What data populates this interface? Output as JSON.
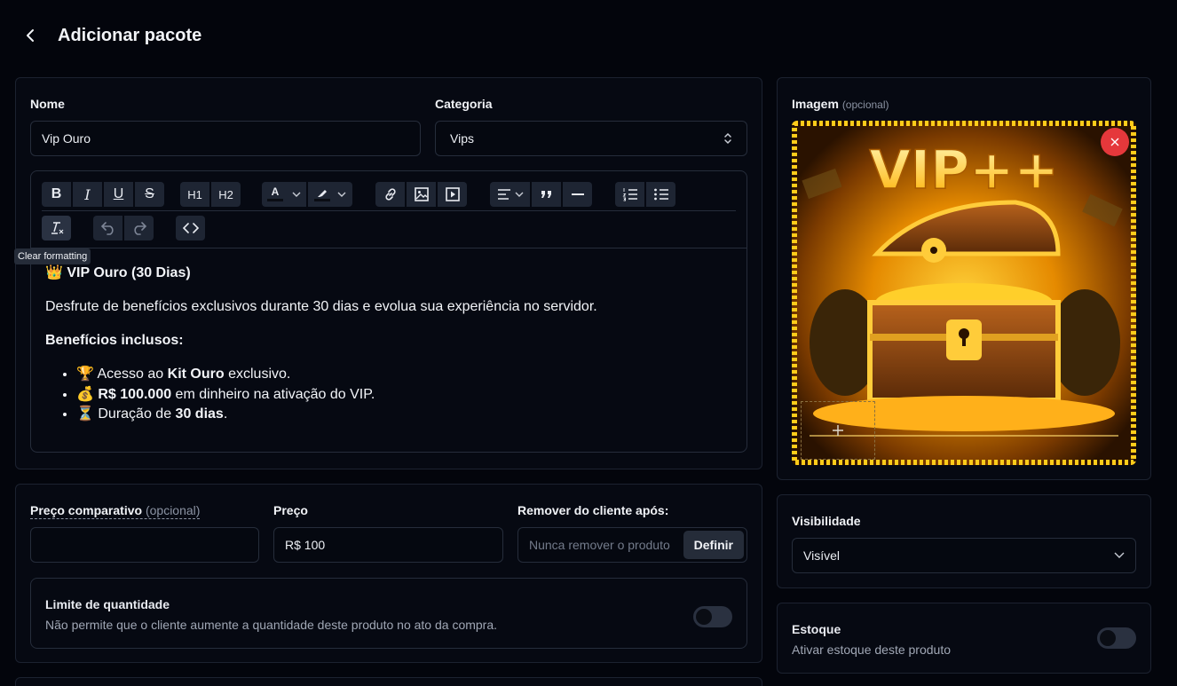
{
  "header": {
    "title": "Adicionar pacote"
  },
  "form": {
    "name_label": "Nome",
    "name_value": "Vip Ouro",
    "category_label": "Categoria",
    "category_value": "Vips"
  },
  "editor": {
    "toolbar_row1": [
      {
        "name": "bold",
        "glyph": "B"
      },
      {
        "name": "italic",
        "glyph": "I"
      },
      {
        "name": "underline",
        "glyph": "U"
      },
      {
        "name": "strikethrough",
        "glyph": "S"
      },
      {
        "name": "heading-1",
        "glyph": "H1"
      },
      {
        "name": "heading-2",
        "glyph": "H2"
      }
    ],
    "text_color_glyph": "A",
    "tooltip": "Clear formatting",
    "content": {
      "title_emoji": "👑",
      "title": "VIP Ouro (30 Dias)",
      "paragraph": "Desfrute de benefícios exclusivos durante 30 dias e evolua sua experiência no servidor.",
      "benefits_heading": "Benefícios inclusos:",
      "items": [
        {
          "emoji": "🏆",
          "pre": "Acesso ao ",
          "bold": "Kit Ouro",
          "post": " exclusivo."
        },
        {
          "emoji": "💰",
          "pre": "",
          "bold": "R$ 100.000",
          "post": " em dinheiro na ativação do VIP."
        },
        {
          "emoji": "⏳",
          "pre": "Duração de ",
          "bold": "30 dias",
          "post": "."
        }
      ]
    }
  },
  "image_card": {
    "label": "Imagem",
    "optional": "(opcional)",
    "banner_text": "VIP++"
  },
  "pricing": {
    "compare_label": "Preço comparativo",
    "compare_optional": "(opcional)",
    "compare_value": "",
    "price_label": "Preço",
    "price_value": "R$ 100",
    "remove_label": "Remover do cliente após:",
    "remove_placeholder": "Nunca remover o produto",
    "define_button": "Definir"
  },
  "quantity_limit": {
    "title": "Limite de quantidade",
    "description": "Não permite que o cliente aumente a quantidade deste produto no ato da compra.",
    "enabled": false
  },
  "visibility": {
    "label": "Visibilidade",
    "value": "Visível"
  },
  "stock": {
    "title": "Estoque",
    "description": "Ativar estoque deste produto",
    "enabled": false
  },
  "colors": {
    "background": "#03050c",
    "card": "#060912",
    "border": "#1c2230",
    "toolbar_button": "#1e2533",
    "remove_image": "#e5383b",
    "gold": "#ffc21a"
  }
}
